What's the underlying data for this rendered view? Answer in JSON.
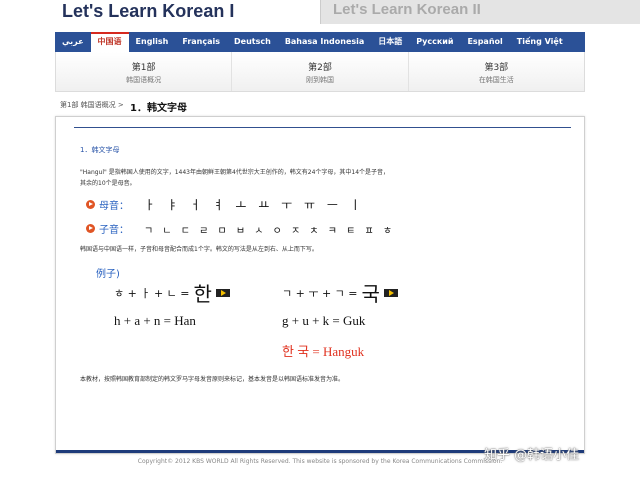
{
  "header": {
    "title1": "Let's Learn Korean I",
    "title2": "Let's Learn Korean II"
  },
  "languages": [
    {
      "label": "عربي",
      "active": false
    },
    {
      "label": "中国语",
      "active": true
    },
    {
      "label": "English",
      "active": false
    },
    {
      "label": "Français",
      "active": false
    },
    {
      "label": "Deutsch",
      "active": false
    },
    {
      "label": "Bahasa Indonesia",
      "active": false
    },
    {
      "label": "日本語",
      "active": false
    },
    {
      "label": "Русский",
      "active": false
    },
    {
      "label": "Español",
      "active": false
    },
    {
      "label": "Tiếng Việt",
      "active": false
    }
  ],
  "parts": [
    {
      "num": "第1部",
      "name": "韩国语概况"
    },
    {
      "num": "第2部",
      "name": "刚到韩国"
    },
    {
      "num": "第3部",
      "name": "在韩国生活"
    }
  ],
  "breadcrumb": {
    "parent": "第1部 韩国语概况 >",
    "current": "1．韩文字母"
  },
  "content": {
    "section_title": "1．韩文字母",
    "intro_line1": "\"Hangul\" 是指韩国人使用的文字，1443年由朝鲜王朝第4代世宗大王创作的，韩文有24个字母，其中14个是子音，",
    "intro_line2": "其余的10个是母音。",
    "vowels_label": "母音：",
    "vowels": "ㅏ ㅑ ㅓ ㅕ ㅗ ㅛ ㅜ ㅠ ㅡ ㅣ",
    "consonants_label": "子音：",
    "consonants": "ㄱ ㄴ ㄷ ㄹ ㅁ ㅂ ㅅ ㅇ ㅈ ㅊ ㅋ ㅌ ㅍ ㅎ",
    "note": "韩国语与中国语一样，子音和母音配合而成1个字。韩文的写法是从左到右、从上而下写。",
    "example_label": "例子)",
    "formula1": "ㅎ + ㅏ + ㄴ =",
    "syllable1": "한",
    "formula2": "ㄱ + ㅜ + ㄱ =",
    "syllable2": "국",
    "roman1": "h + a + n = Han",
    "roman2": "g + u + k = Guk",
    "hanguk": "한 국 = Hanguk",
    "bottom_note": "本教材，按照韩国教育部制定的韩文罗马字母发音原则来标记，基本发音是以韩国语标准发音为准。"
  },
  "footer": {
    "text": "Copyright© 2012 KBS WORLD All Rights Reserved. This website is sponsored by the Korea Communications Commission."
  },
  "watermark": "知乎 @韩语小佳",
  "colors": {
    "nav_blue": "#2b5197",
    "active_red": "#d6291f",
    "label_blue": "#2a62c0",
    "hanguk_red": "#e0301e"
  }
}
